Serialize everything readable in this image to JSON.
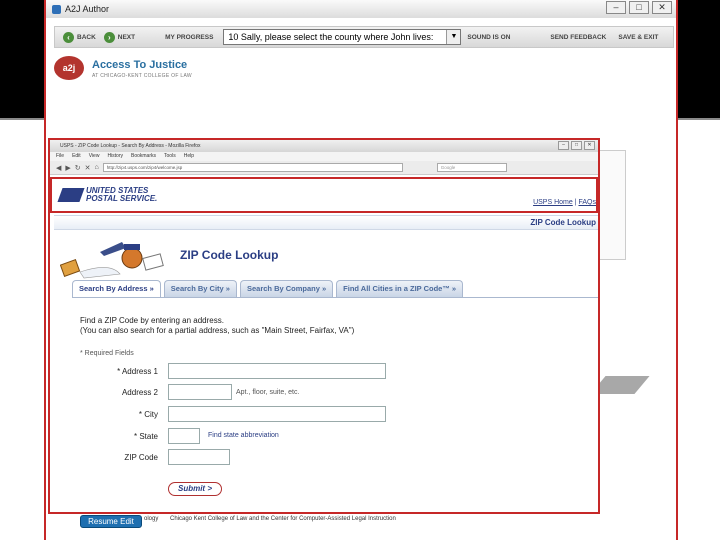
{
  "a2j": {
    "window_title": "A2J Author",
    "toolbar": {
      "back": "BACK",
      "next": "NEXT",
      "progress": "MY PROGRESS",
      "question": "10 Sally, please select the county where John lives:",
      "sound": "SOUND IS ON",
      "feedback": "SEND FEEDBACK",
      "save_exit": "SAVE & EXIT"
    },
    "logo_text": "a2j",
    "brand_name": "Access To Justice",
    "brand_sub": "AT CHICAGO-KENT COLLEGE OF LAW",
    "resume_label": "Resume Edit",
    "footer_fragment": "ology",
    "footer_credit": "Chicago Kent College of Law and the Center for Computer-Assisted Legal Instruction"
  },
  "browser": {
    "title": "USPS - ZIP Code Lookup - Search By Address - Mozilla Firefox",
    "menu": [
      "File",
      "Edit",
      "View",
      "History",
      "Bookmarks",
      "Tools",
      "Help"
    ],
    "url": "http://zip4.usps.com/zip4/welcome.jsp",
    "search_placeholder": "Google"
  },
  "usps": {
    "brand_line1": "UNITED STATES",
    "brand_line2": "POSTAL SERVICE.",
    "home_link": "USPS Home",
    "link_sep": "|",
    "faq_link": "FAQs",
    "subbar_title": "ZIP Code Lookup",
    "heading": "ZIP Code Lookup",
    "tabs": [
      "Search By Address »",
      "Search By City »",
      "Search By Company »",
      "Find All Cities in a ZIP Code™ »"
    ],
    "intro1": "Find a ZIP Code by entering an address.",
    "intro2": "(You can also search for a partial address, such as \"Main Street, Fairfax, VA\")",
    "required_note": "* Required Fields",
    "fields": {
      "address1": "* Address 1",
      "address2": "Address 2",
      "address2_hint": "Apt., floor, suite, etc.",
      "city": "* City",
      "state": "* State",
      "state_hint": "Find state abbreviation",
      "zip": "ZIP Code"
    },
    "submit": "Submit >"
  }
}
